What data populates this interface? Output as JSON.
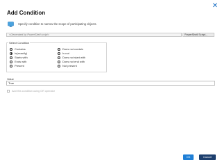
{
  "dialog": {
    "title": "Add Condition",
    "subtitle": "Specify condition to narrow the scope of participating objects.",
    "close_icon": "close-icon",
    "info_icon": "monitor-icon"
  },
  "identity": {
    "selected": "<Generated by PowerShell script>",
    "type": "PowerShell Script..."
  },
  "select_condition": {
    "label": "Select Condition",
    "left_options": [
      "Contains",
      "Is(exactly)",
      "Starts with",
      "Ends with",
      "Present"
    ],
    "right_options": [
      "Does not contain",
      "Is not",
      "Does not start with",
      "Does not end with",
      "Not present"
    ],
    "selected": "Is(exactly)"
  },
  "value": {
    "label": "Value",
    "text": "True"
  },
  "or_checkbox": {
    "label": "Add this condition using OR operator"
  },
  "buttons": {
    "ok": "OK",
    "cancel": "Cancel"
  },
  "colors": {
    "accent": "#1f7fd6",
    "cancel": "#1d3f6e"
  }
}
